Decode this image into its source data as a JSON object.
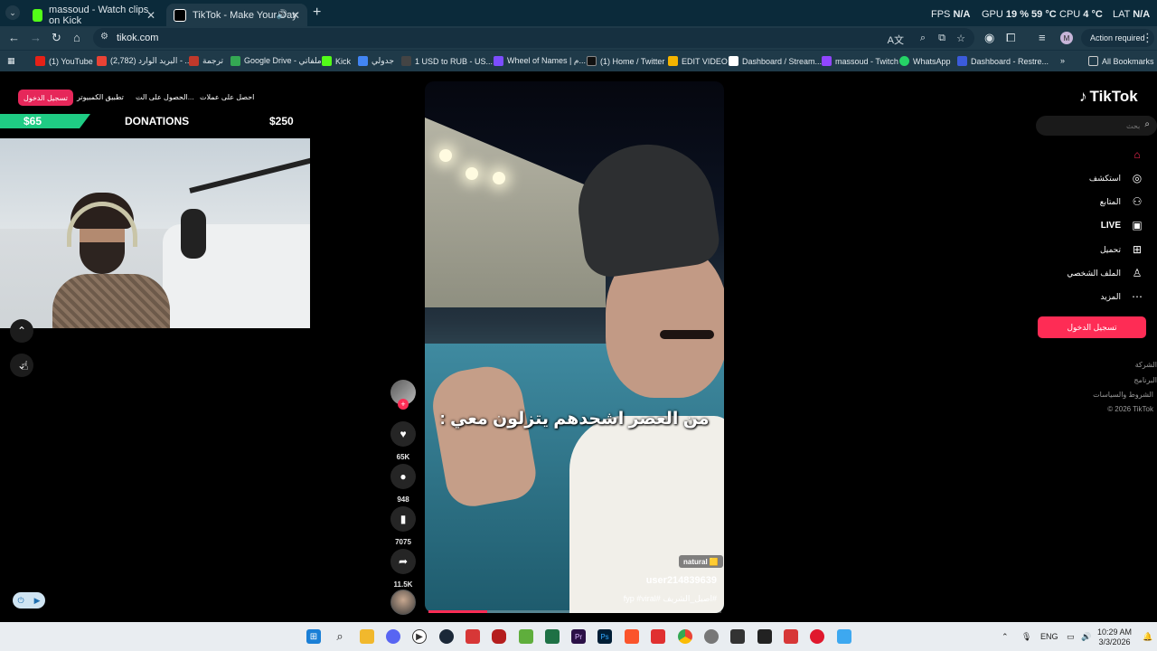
{
  "browser": {
    "tabs": [
      {
        "title": "massoud - Watch clips on Kick",
        "icon": "kick-icon"
      },
      {
        "title": "TikTok - Make Your Day",
        "icon": "tiktok-icon"
      }
    ],
    "url": "tikok.com",
    "action_required": "Action required",
    "overlay": {
      "fps_label": "FPS",
      "fps_value": "N/A",
      "gpu_label": "GPU",
      "gpu_value": "19 % 59 °C",
      "cpu_label": "CPU",
      "cpu_value": "4 °C",
      "lat_label": "LAT",
      "lat_value": "N/A"
    },
    "bookmarks": [
      {
        "label": "(1) YouTube",
        "color": "#e62117"
      },
      {
        "label": "البريد الوارد (2,782) - ...",
        "color": "#ea4335"
      },
      {
        "label": "ترجمة",
        "color": "#c0392b"
      },
      {
        "label": "Google Drive - ملفاتي",
        "color": "#34a853"
      },
      {
        "label": "Kick",
        "color": "#53fc18"
      },
      {
        "label": "جدولي",
        "color": "#4285f4"
      },
      {
        "label": "1 USD to RUB - US...",
        "color": "#1a1a1a"
      },
      {
        "label": "Wheel of Names | م...",
        "color": "#7c4dff"
      },
      {
        "label": "(1) Home / Twitter",
        "color": "#111111"
      },
      {
        "label": "EDIT VIDEO",
        "color": "#f4b400"
      },
      {
        "label": "Dashboard / Stream...",
        "color": "#ffffff"
      },
      {
        "label": "massoud - Twitch",
        "color": "#9146ff"
      },
      {
        "label": "WhatsApp",
        "color": "#25d366"
      },
      {
        "label": "Dashboard - Restre...",
        "color": "#3b5bdb"
      }
    ],
    "all_bookmarks": "All Bookmarks"
  },
  "stream_overlay": {
    "signin": "تسجيل الدخول",
    "links": [
      "تطبيق الكمبيوتر",
      "الحصول على الت...",
      "احصل على عملات"
    ],
    "donations_current": "$65",
    "donations_label": "DONATIONS",
    "donations_goal": "$250"
  },
  "video": {
    "caption": "من العصر اشحدهم يتزلون معي :",
    "badge": "natural 🟨",
    "username": "user214839639",
    "tags": "#اصيل_الشريف #fyp #viral",
    "progress": 0.2
  },
  "actions": {
    "likes": "65K",
    "comments": "948",
    "saves": "7075",
    "shares": "11.5K"
  },
  "tiktok": {
    "logo": "TikTok",
    "search_placeholder": "بحث",
    "nav": [
      {
        "label": "",
        "icon": "home-icon"
      },
      {
        "label": "استكشف",
        "icon": "compass-icon"
      },
      {
        "label": "المتابع",
        "icon": "user-plus-icon"
      },
      {
        "label": "LIVE",
        "icon": "live-icon"
      },
      {
        "label": "تحميل",
        "icon": "upload-icon"
      },
      {
        "label": "الملف الشخصي",
        "icon": "profile-icon"
      },
      {
        "label": "المزيد",
        "icon": "more-icon"
      }
    ],
    "login": "تسجيل الدخول",
    "footer": [
      "الشركة",
      "البرنامج",
      "الشروط والسياسات",
      "© 2026 TikTok"
    ]
  },
  "taskbar": {
    "lang": "ENG",
    "time": "10:29 AM",
    "date": "3/3/2026"
  }
}
